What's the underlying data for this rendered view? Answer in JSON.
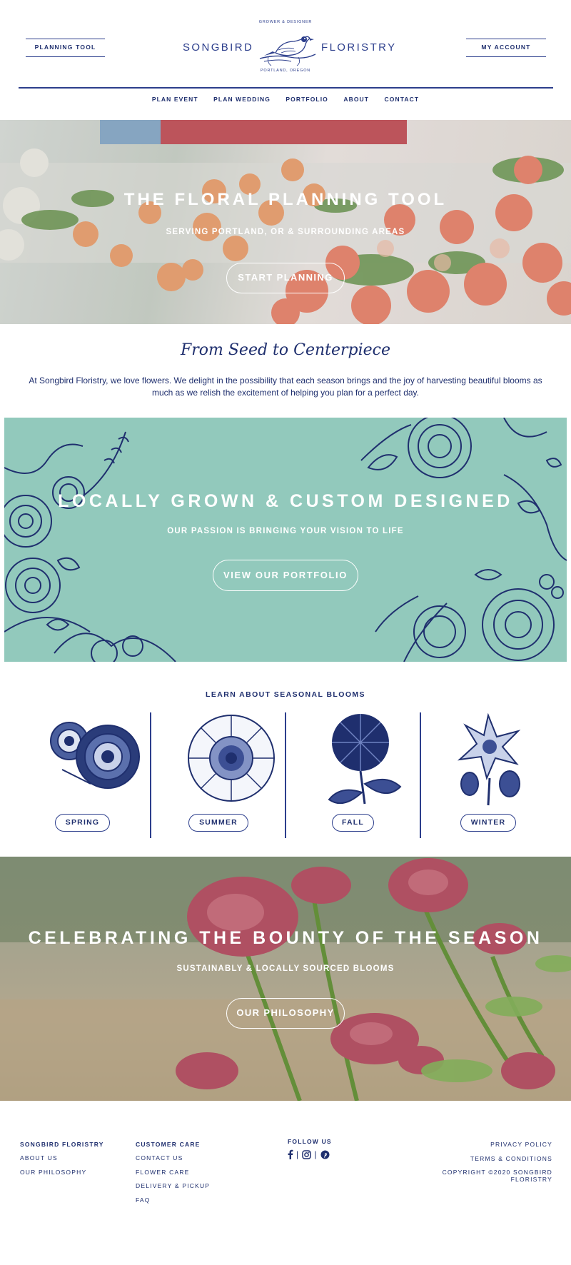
{
  "header": {
    "planning_tool": "Planning Tool",
    "my_account": "My Account",
    "logo_left": "SONGBIRD",
    "logo_right": "FLORISTRY",
    "logo_top": "GROWER & DESIGNER",
    "logo_bottom": "PORTLAND, OREGON"
  },
  "nav": {
    "items": [
      "Plan Event",
      "Plan Wedding",
      "Portfolio",
      "About",
      "Contact"
    ]
  },
  "hero": {
    "title": "The Floral Planning Tool",
    "subtitle": "Serving Portland, OR & Surrounding Areas",
    "button": "Start Planning"
  },
  "intro": {
    "script": "From Seed to Centerpiece",
    "text": "At Songbird Floristry, we love flowers. We delight in the possibility that each season brings and the joy of harvesting beautiful blooms as much as we relish the excitement of helping you plan for a perfect day."
  },
  "banner": {
    "title": "Locally Grown & Custom Designed",
    "subtitle": "Our Passion is Bringing Your Vision to Life",
    "button": "View Our Portfolio"
  },
  "seasons": {
    "title": "LEARN ABOUT SEASONAL BLOOMS",
    "items": [
      {
        "label": "Spring",
        "icon": "rose-icon"
      },
      {
        "label": "Summer",
        "icon": "scabiosa-icon"
      },
      {
        "label": "Fall",
        "icon": "chrysanthemum-icon"
      },
      {
        "label": "Winter",
        "icon": "hellebore-icon"
      }
    ]
  },
  "hero2": {
    "title": "Celebrating the Bounty of the Season",
    "subtitle": "Sustainably & Locally Sourced Blooms",
    "button": "Our Philosophy"
  },
  "footer": {
    "col1": {
      "head": "Songbird Floristry",
      "links": [
        "About Us",
        "Our Philosophy"
      ]
    },
    "col2": {
      "head": "Customer Care",
      "links": [
        "Contact Us",
        "Flower Care",
        "Delivery & Pickup",
        "FAQ"
      ]
    },
    "follow": {
      "head": "Follow Us",
      "icons": [
        "facebook-icon",
        "instagram-icon",
        "pinterest-icon"
      ],
      "separator": "|"
    },
    "legal": {
      "links": [
        "Privacy Policy",
        "Terms & Conditions"
      ],
      "copyright": "Copyright ©2020 Songbird Floristry"
    }
  },
  "colors": {
    "navy": "#1f2f6e",
    "teal": "#92c9bc",
    "white": "#ffffff"
  }
}
